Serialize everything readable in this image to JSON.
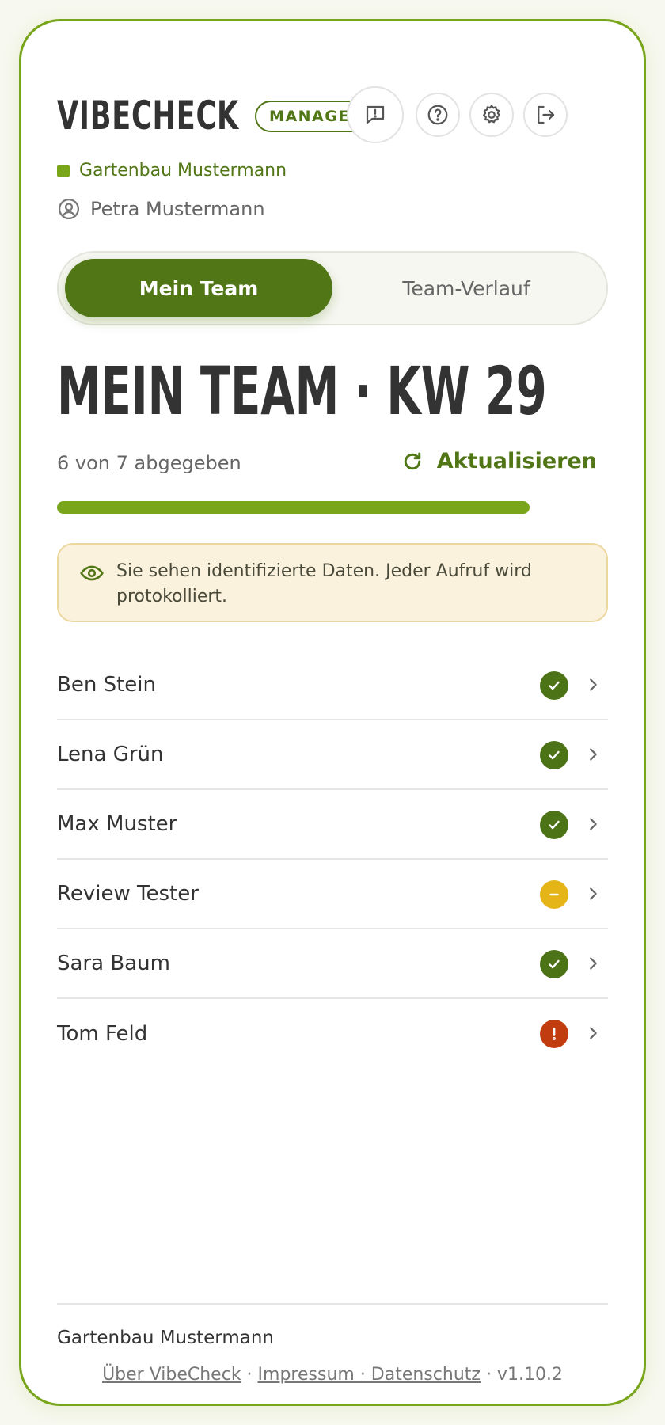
{
  "header": {
    "logo": "VIBECHECK",
    "role_badge": "MANAGER",
    "icons": [
      "feedback-icon",
      "help-icon",
      "settings-icon",
      "logout-icon"
    ]
  },
  "org_name": "Gartenbau Mustermann",
  "user_name": "Petra Mustermann",
  "tabs": [
    {
      "label": "Mein Team",
      "active": true
    },
    {
      "label": "Team-Verlauf",
      "active": false
    }
  ],
  "page_title": "MEIN TEAM · KW 29",
  "progress": {
    "text": "6 von 7 abgegeben",
    "submitted": 6,
    "total": 7
  },
  "refresh_label": "Aktualisieren",
  "notice": "Sie sehen identifizierte Daten. Jeder Aufruf wird protokolliert.",
  "members": [
    {
      "name": "Ben Stein",
      "status": "ok"
    },
    {
      "name": "Lena Grün",
      "status": "ok"
    },
    {
      "name": "Max Muster",
      "status": "ok"
    },
    {
      "name": "Review Tester",
      "status": "pending"
    },
    {
      "name": "Sara Baum",
      "status": "ok"
    },
    {
      "name": "Tom Feld",
      "status": "alert"
    }
  ],
  "status_colors": {
    "ok": "#4d7317",
    "pending": "#e5b416",
    "alert": "#c13c0f"
  },
  "footer": {
    "org": "Gartenbau Mustermann",
    "link_about": "Über VibeCheck",
    "sep1": " · ",
    "link_imprint": "Impressum · Datenschutz",
    "version": " · v1.10.2"
  }
}
